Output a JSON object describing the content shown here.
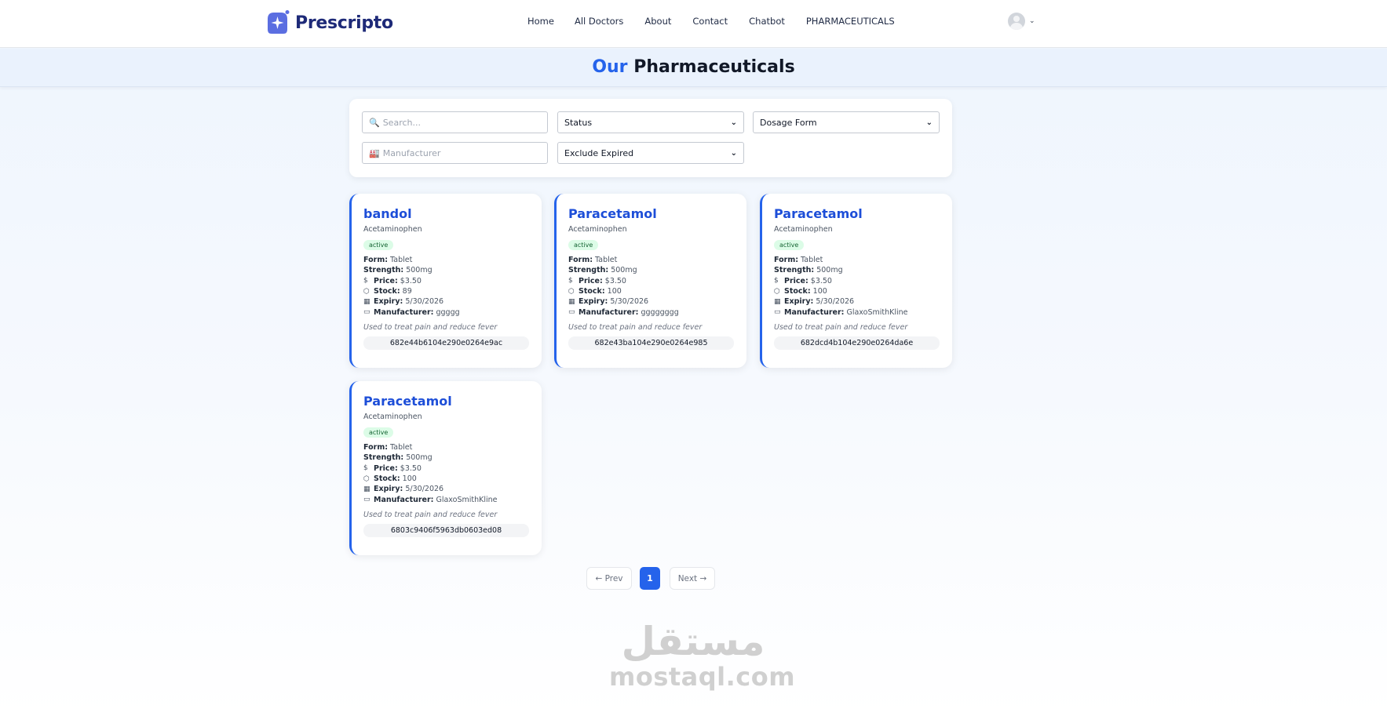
{
  "nav": {
    "brand": "Prescripto",
    "links": [
      "Home",
      "All Doctors",
      "About",
      "Contact",
      "Chatbot",
      "PHARMACEUTICALS"
    ],
    "profile_chevron": "⌄"
  },
  "page": {
    "title_accent": "Our",
    "title_rest": "Pharmaceuticals"
  },
  "filters": {
    "search_placeholder": "Search...",
    "search_icon": "magnifier-icon",
    "status_label": "Status",
    "dosage_label": "Dosage Form",
    "manufacturer_placeholder": "Manufacturer",
    "manufacturer_icon": "factory-icon",
    "expired_label": "Exclude Expired"
  },
  "labels": {
    "form": "Form:",
    "strength": "Strength:",
    "price": "Price:",
    "stock": "Stock:",
    "expiry": "Expiry:",
    "manufacturer": "Manufacturer:"
  },
  "cards": [
    {
      "name": "bandol",
      "generic": "Acetaminophen",
      "status": "active",
      "form": "Tablet",
      "strength": "500mg",
      "price": "$3.50",
      "stock": "89",
      "expiry": "5/30/2026",
      "manufacturer": "ggggg",
      "description": "Used to treat pain and reduce fever",
      "id": "682e44b6104e290e0264e9ac"
    },
    {
      "name": "Paracetamol",
      "generic": "Acetaminophen",
      "status": "active",
      "form": "Tablet",
      "strength": "500mg",
      "price": "$3.50",
      "stock": "100",
      "expiry": "5/30/2026",
      "manufacturer": "gggggggg",
      "description": "Used to treat pain and reduce fever",
      "id": "682e43ba104e290e0264e985"
    },
    {
      "name": "Paracetamol",
      "generic": "Acetaminophen",
      "status": "active",
      "form": "Tablet",
      "strength": "500mg",
      "price": "$3.50",
      "stock": "100",
      "expiry": "5/30/2026",
      "manufacturer": "GlaxoSmithKline",
      "description": "Used to treat pain and reduce fever",
      "id": "682dcd4b104e290e0264da6e"
    },
    {
      "name": "Paracetamol",
      "generic": "Acetaminophen",
      "status": "active",
      "form": "Tablet",
      "strength": "500mg",
      "price": "$3.50",
      "stock": "100",
      "expiry": "5/30/2026",
      "manufacturer": "GlaxoSmithKline",
      "description": "Used to treat pain and reduce fever",
      "id": "6803c9406f5963db0603ed08"
    }
  ],
  "pagination": {
    "prev": "← Prev",
    "current": "1",
    "next": "Next →"
  },
  "watermark": {
    "arabic": "مستقل",
    "latin": "mostaql.com"
  },
  "colors": {
    "accent": "#2563eb",
    "brand": "#1e2a78",
    "badge_bg": "#dcfce7",
    "badge_text": "#166534"
  }
}
